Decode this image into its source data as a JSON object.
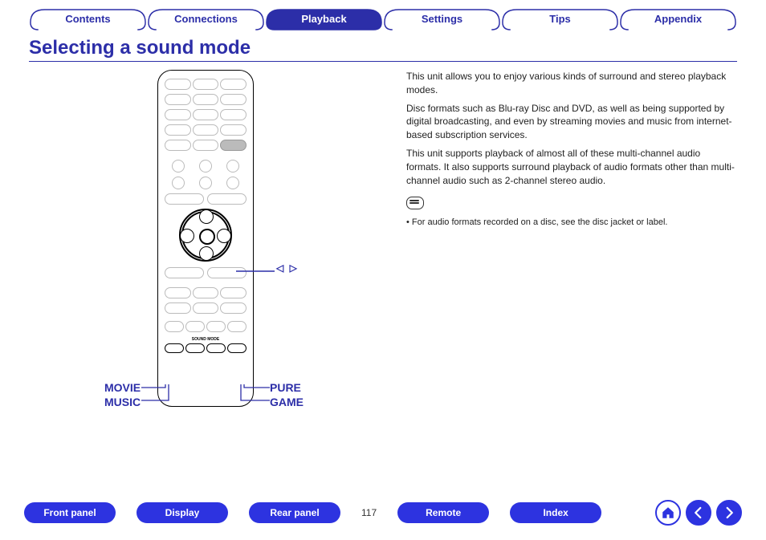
{
  "nav": {
    "tabs": [
      {
        "label": "Contents",
        "active": false
      },
      {
        "label": "Connections",
        "active": false
      },
      {
        "label": "Playback",
        "active": true
      },
      {
        "label": "Settings",
        "active": false
      },
      {
        "label": "Tips",
        "active": false
      },
      {
        "label": "Appendix",
        "active": false
      }
    ]
  },
  "title": "Selecting a sound mode",
  "remote_callouts": {
    "arrows": "◁ ▷",
    "movie": "MOVIE",
    "music": "MUSIC",
    "pure": "PURE",
    "game": "GAME",
    "sound_mode_label": "SOUND MODE"
  },
  "body": {
    "p1": "This unit allows you to enjoy various kinds of surround and stereo playback modes.",
    "p2": "Disc formats such as Blu-ray Disc and DVD, as well as being supported by digital broadcasting, and even by streaming movies and music from internet-based subscription services.",
    "p3": "This unit supports playback of almost all of these multi-channel audio formats. It also supports surround playback of audio formats other than multi-channel audio such as 2-channel stereo audio.",
    "note": "For audio formats recorded on a disc, see the disc jacket or label."
  },
  "footer": {
    "buttons": [
      "Front panel",
      "Display",
      "Rear panel",
      "Remote",
      "Index"
    ],
    "page": "117"
  }
}
